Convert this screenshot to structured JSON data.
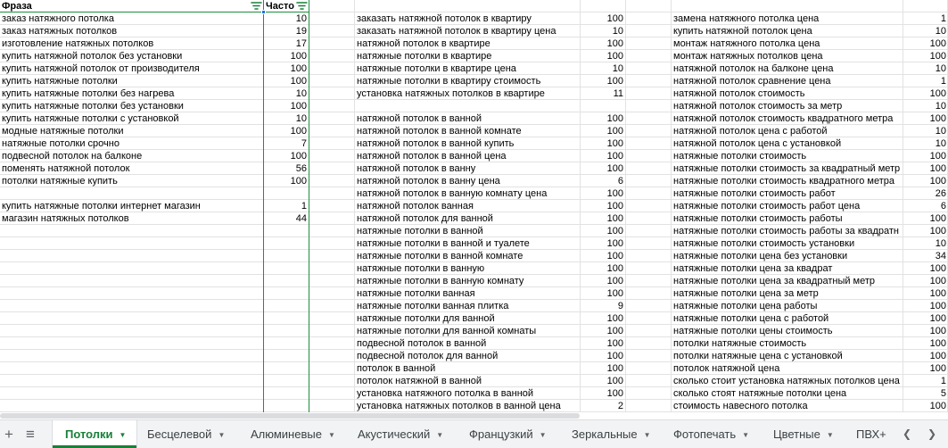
{
  "sheet": {
    "header": {
      "phrase": "Фраза",
      "freq": "Часто"
    },
    "col_a": [
      [
        "заказ натяжного потолка",
        "10"
      ],
      [
        "заказ натяжных потолков",
        "19"
      ],
      [
        "изготовление натяжных потолков",
        "17"
      ],
      [
        "купить натяжной потолок без установки",
        "100"
      ],
      [
        "купить натяжной потолок от производителя",
        "100"
      ],
      [
        "купить натяжные потолки",
        "100"
      ],
      [
        "купить натяжные потолки без нагрева",
        "10"
      ],
      [
        "купить натяжные потолки без установки",
        "100"
      ],
      [
        "купить натяжные потолки с установкой",
        "10"
      ],
      [
        "модные натяжные потолки",
        "100"
      ],
      [
        "натяжные потолки срочно",
        "7"
      ],
      [
        "подвесной потолок на балконе",
        "100"
      ],
      [
        "поменять натяжной потолок",
        "56"
      ],
      [
        "потолки натяжные купить",
        "100"
      ],
      [
        "",
        ""
      ],
      [
        "купить натяжные потолки интернет магазин",
        "1"
      ],
      [
        "магазин натяжных потолков",
        "44"
      ]
    ],
    "col_b": [
      [
        "заказать натяжной потолок в квартиру",
        "100"
      ],
      [
        "заказать натяжной потолок в квартиру цена",
        "10"
      ],
      [
        "натяжной потолок в квартире",
        "100"
      ],
      [
        "натяжные потолки в квартире",
        "100"
      ],
      [
        "натяжные потолки в квартире цена",
        "10"
      ],
      [
        "натяжные потолки в квартиру стоимость",
        "100"
      ],
      [
        "установка натяжных потолков в квартире",
        "11"
      ],
      [
        "",
        ""
      ],
      [
        "натяжной потолок в ванной",
        "100"
      ],
      [
        "натяжной потолок в ванной комнате",
        "100"
      ],
      [
        "натяжной потолок в ванной купить",
        "100"
      ],
      [
        "натяжной потолок в ванной цена",
        "100"
      ],
      [
        "натяжной потолок в ванну",
        "100"
      ],
      [
        "натяжной потолок в ванну цена",
        "6"
      ],
      [
        "натяжной потолок в ванную комнату цена",
        "100"
      ],
      [
        "натяжной потолок ванная",
        "100"
      ],
      [
        "натяжной потолок для ванной",
        "100"
      ],
      [
        "натяжные потолки в ванной",
        "100"
      ],
      [
        "натяжные потолки в ванной и туалете",
        "100"
      ],
      [
        "натяжные потолки в ванной комнате",
        "100"
      ],
      [
        "натяжные потолки в ванную",
        "100"
      ],
      [
        "натяжные потолки в ванную комнату",
        "100"
      ],
      [
        "натяжные потолки ванная",
        "100"
      ],
      [
        "натяжные потолки ванная плитка",
        "9"
      ],
      [
        "натяжные потолки для ванной",
        "100"
      ],
      [
        "натяжные потолки для ванной комнаты",
        "100"
      ],
      [
        "подвесной потолок в ванной",
        "100"
      ],
      [
        "подвесной потолок для ванной",
        "100"
      ],
      [
        "потолок в ванной",
        "100"
      ],
      [
        "потолок натяжной в ванной",
        "100"
      ],
      [
        "установка натяжного потолка в ванной",
        "100"
      ],
      [
        "установка натяжных потолков в ванной цена",
        "2"
      ]
    ],
    "col_c": [
      [
        "замена натяжного потолка цена",
        "1"
      ],
      [
        "купить натяжной потолок цена",
        "10"
      ],
      [
        "монтаж натяжного потолка цена",
        "100"
      ],
      [
        "монтаж натяжных потолков цена",
        "100"
      ],
      [
        "натяжной потолок на балконе цена",
        "10"
      ],
      [
        "натяжной потолок сравнение цена",
        "1"
      ],
      [
        "натяжной потолок стоимость",
        "100"
      ],
      [
        "натяжной потолок стоимость за метр",
        "10"
      ],
      [
        "натяжной потолок стоимость квадратного метра",
        "100"
      ],
      [
        "натяжной потолок цена с работой",
        "10"
      ],
      [
        "натяжной потолок цена с установкой",
        "10"
      ],
      [
        "натяжные потолки стоимость",
        "100"
      ],
      [
        "натяжные потолки стоимость за квадратный метр",
        "100"
      ],
      [
        "натяжные потолки стоимость квадратного метра",
        "100"
      ],
      [
        "натяжные потолки стоимость работ",
        "26"
      ],
      [
        "натяжные потолки стоимость работ цена",
        "6"
      ],
      [
        "натяжные потолки стоимость работы",
        "100"
      ],
      [
        "натяжные потолки стоимость работы за квадратн",
        "100"
      ],
      [
        "натяжные потолки стоимость установки",
        "10"
      ],
      [
        "натяжные потолки цена без установки",
        "34"
      ],
      [
        "натяжные потолки цена за квадрат",
        "100"
      ],
      [
        "натяжные потолки цена за квадратный метр",
        "100"
      ],
      [
        "натяжные потолки цена за метр",
        "100"
      ],
      [
        "натяжные потолки цена работы",
        "100"
      ],
      [
        "натяжные потолки цена с работой",
        "100"
      ],
      [
        "натяжные потолки цены стоимость",
        "100"
      ],
      [
        "потолки натяжные стоимость",
        "100"
      ],
      [
        "потолки натяжные цена с установкой",
        "100"
      ],
      [
        "потолок натяжной цена",
        "100"
      ],
      [
        "сколько стоит установка натяжных потолков цена",
        "1"
      ],
      [
        "сколько стоят натяжные потолки цена",
        "5"
      ],
      [
        "стоимость навесного потолка",
        "100"
      ]
    ]
  },
  "tabs": [
    {
      "label": "Потолки",
      "active": true
    },
    {
      "label": "Бесцелевой"
    },
    {
      "label": "Алюминевые"
    },
    {
      "label": "Акустический"
    },
    {
      "label": "Французкий"
    },
    {
      "label": "Зеркальные"
    },
    {
      "label": "Фотопечать"
    },
    {
      "label": "Цветные"
    },
    {
      "label": "ПВХ+ г"
    }
  ],
  "icons": {
    "add_sheet": "plus-icon",
    "all_sheets": "menu-icon",
    "tab_menu": "caret-down-icon",
    "scroll_left": "chevron-left-icon",
    "scroll_right": "chevron-right-icon",
    "filter": "filter-icon"
  },
  "colors": {
    "accent": "#188038",
    "selection": "#1e8e3e",
    "handle": "#1a73e8",
    "gridline": "#e2e2e2",
    "tabbar": "#f1f3f4"
  }
}
